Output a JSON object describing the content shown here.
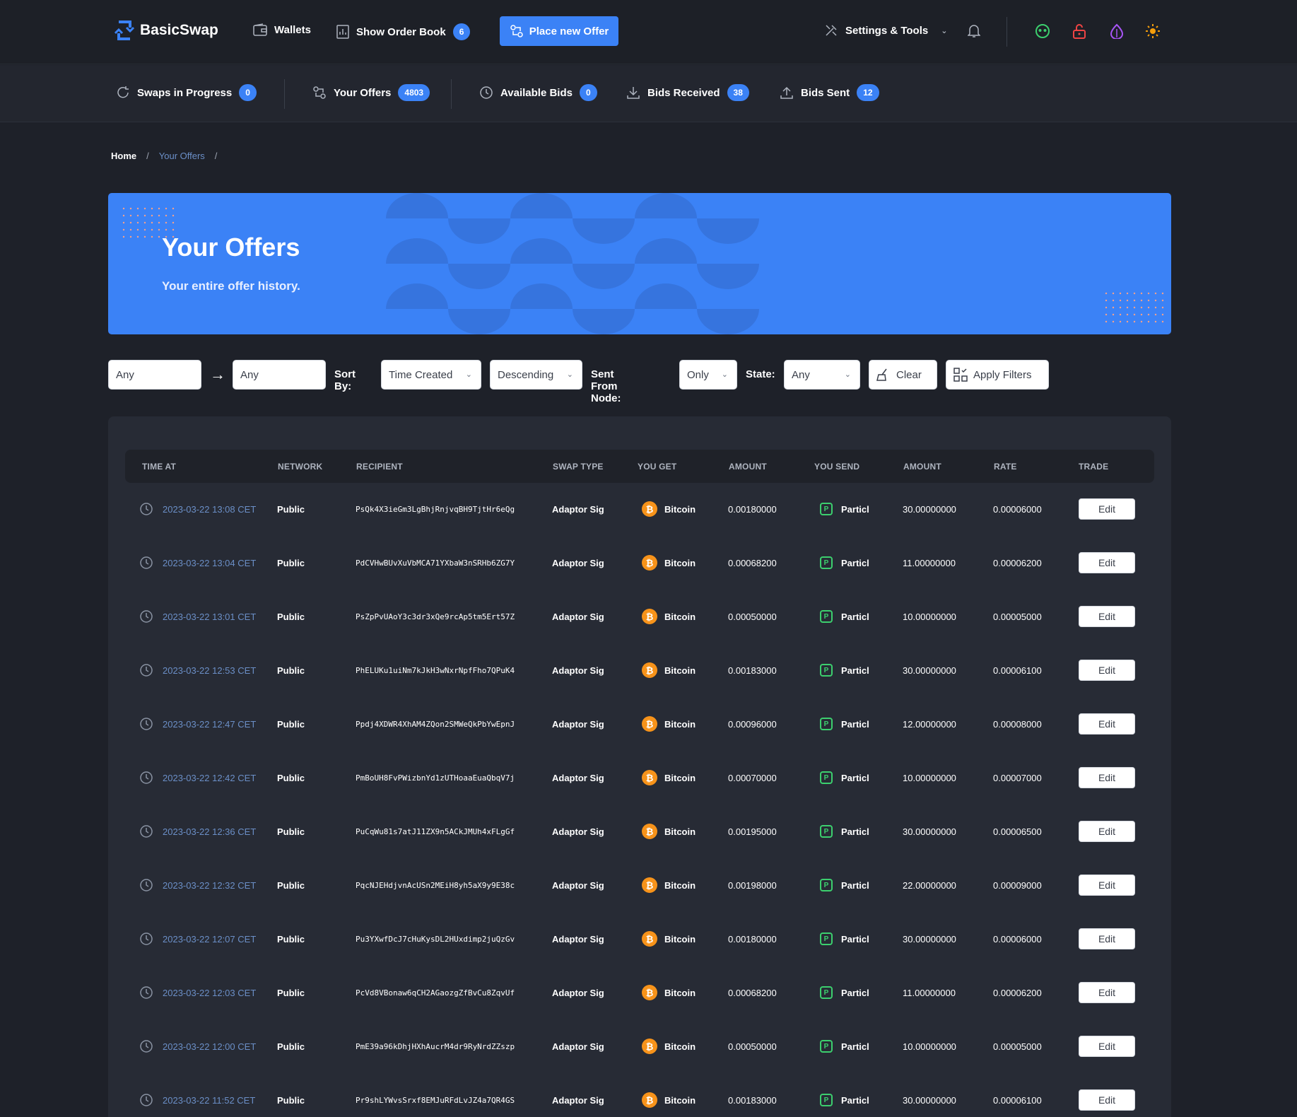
{
  "nav": {
    "brand": "BasicSwap",
    "wallets": "Wallets",
    "order_book": "Show Order Book",
    "order_book_count": "6",
    "place_offer": "Place new Offer",
    "settings": "Settings & Tools"
  },
  "subnav": {
    "swaps_in_progress": "Swaps in Progress",
    "swaps_count": "0",
    "your_offers": "Your Offers",
    "offers_count": "4803",
    "available_bids": "Available Bids",
    "available_count": "0",
    "bids_received": "Bids Received",
    "received_count": "38",
    "bids_sent": "Bids Sent",
    "sent_count": "12"
  },
  "breadcrumb": {
    "home": "Home",
    "current": "Your Offers",
    "sep": "/"
  },
  "hero": {
    "title": "Your Offers",
    "subtitle": "Your entire offer history."
  },
  "filters": {
    "coin_from": "Any",
    "coin_to": "Any",
    "sort_by_label": "Sort By:",
    "sort_by": "Time Created",
    "order": "Descending",
    "sent_from_label": "Sent From Node:",
    "sent_from": "Only",
    "state_label": "State:",
    "state": "Any",
    "clear": "Clear",
    "apply": "Apply Filters"
  },
  "table": {
    "headers": [
      "TIME AT",
      "NETWORK",
      "RECIPIENT",
      "SWAP TYPE",
      "YOU GET",
      "AMOUNT",
      "YOU SEND",
      "AMOUNT",
      "RATE",
      "TRADE"
    ],
    "edit_label": "Edit",
    "rows": [
      {
        "time": "2023-03-22 13:08 CET",
        "network": "Public",
        "recipient": "PsQk4X3ieGm3LgBhjRnjvqBH9TjtHr6eQg",
        "swap_type": "Adaptor Sig",
        "get_coin": "Bitcoin",
        "get_amount": "0.00180000",
        "send_coin": "Particl",
        "send_amount": "30.00000000",
        "rate": "0.00006000"
      },
      {
        "time": "2023-03-22 13:04 CET",
        "network": "Public",
        "recipient": "PdCVHwBUvXuVbMCA71YXbaW3nSRHb6ZG7Y",
        "swap_type": "Adaptor Sig",
        "get_coin": "Bitcoin",
        "get_amount": "0.00068200",
        "send_coin": "Particl",
        "send_amount": "11.00000000",
        "rate": "0.00006200"
      },
      {
        "time": "2023-03-22 13:01 CET",
        "network": "Public",
        "recipient": "PsZpPvUAoY3c3dr3xQe9rcAp5tm5Ert57Z",
        "swap_type": "Adaptor Sig",
        "get_coin": "Bitcoin",
        "get_amount": "0.00050000",
        "send_coin": "Particl",
        "send_amount": "10.00000000",
        "rate": "0.00005000"
      },
      {
        "time": "2023-03-22 12:53 CET",
        "network": "Public",
        "recipient": "PhELUKu1uiNm7kJkH3wNxrNpfFho7QPuK4",
        "swap_type": "Adaptor Sig",
        "get_coin": "Bitcoin",
        "get_amount": "0.00183000",
        "send_coin": "Particl",
        "send_amount": "30.00000000",
        "rate": "0.00006100"
      },
      {
        "time": "2023-03-22 12:47 CET",
        "network": "Public",
        "recipient": "Ppdj4XDWR4XhAM4ZQon2SMWeQkPbYwEpnJ",
        "swap_type": "Adaptor Sig",
        "get_coin": "Bitcoin",
        "get_amount": "0.00096000",
        "send_coin": "Particl",
        "send_amount": "12.00000000",
        "rate": "0.00008000"
      },
      {
        "time": "2023-03-22 12:42 CET",
        "network": "Public",
        "recipient": "PmBoUH8FvPWizbnYd1zUTHoaaEuaQbqV7j",
        "swap_type": "Adaptor Sig",
        "get_coin": "Bitcoin",
        "get_amount": "0.00070000",
        "send_coin": "Particl",
        "send_amount": "10.00000000",
        "rate": "0.00007000"
      },
      {
        "time": "2023-03-22 12:36 CET",
        "network": "Public",
        "recipient": "PuCqWu81s7atJ11ZX9n5ACkJMUh4xFLgGf",
        "swap_type": "Adaptor Sig",
        "get_coin": "Bitcoin",
        "get_amount": "0.00195000",
        "send_coin": "Particl",
        "send_amount": "30.00000000",
        "rate": "0.00006500"
      },
      {
        "time": "2023-03-22 12:32 CET",
        "network": "Public",
        "recipient": "PqcNJEHdjvnAcUSn2MEiH8yh5aX9y9E38c",
        "swap_type": "Adaptor Sig",
        "get_coin": "Bitcoin",
        "get_amount": "0.00198000",
        "send_coin": "Particl",
        "send_amount": "22.00000000",
        "rate": "0.00009000"
      },
      {
        "time": "2023-03-22 12:07 CET",
        "network": "Public",
        "recipient": "Pu3YXwfDcJ7cHuKysDL2HUxdimp2juQzGv",
        "swap_type": "Adaptor Sig",
        "get_coin": "Bitcoin",
        "get_amount": "0.00180000",
        "send_coin": "Particl",
        "send_amount": "30.00000000",
        "rate": "0.00006000"
      },
      {
        "time": "2023-03-22 12:03 CET",
        "network": "Public",
        "recipient": "PcVd8VBonaw6qCH2AGaozgZfBvCu8ZqvUf",
        "swap_type": "Adaptor Sig",
        "get_coin": "Bitcoin",
        "get_amount": "0.00068200",
        "send_coin": "Particl",
        "send_amount": "11.00000000",
        "rate": "0.00006200"
      },
      {
        "time": "2023-03-22 12:00 CET",
        "network": "Public",
        "recipient": "PmE39a96kDhjHXhAucrM4dr9RyNrdZZszp",
        "swap_type": "Adaptor Sig",
        "get_coin": "Bitcoin",
        "get_amount": "0.00050000",
        "send_coin": "Particl",
        "send_amount": "10.00000000",
        "rate": "0.00005000"
      },
      {
        "time": "2023-03-22 11:52 CET",
        "network": "Public",
        "recipient": "Pr9shLYWvsSrxf8EMJuRFdLvJZ4a7QR4GS",
        "swap_type": "Adaptor Sig",
        "get_coin": "Bitcoin",
        "get_amount": "0.00183000",
        "send_coin": "Particl",
        "send_amount": "30.00000000",
        "rate": "0.00006100"
      }
    ]
  }
}
